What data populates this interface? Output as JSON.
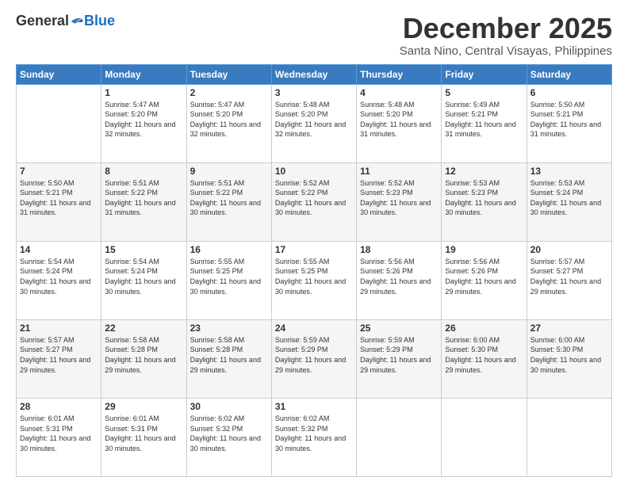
{
  "header": {
    "logo": {
      "general": "General",
      "blue": "Blue"
    },
    "title": "December 2025",
    "location": "Santa Nino, Central Visayas, Philippines"
  },
  "calendar": {
    "days_of_week": [
      "Sunday",
      "Monday",
      "Tuesday",
      "Wednesday",
      "Thursday",
      "Friday",
      "Saturday"
    ],
    "weeks": [
      [
        {
          "day": "",
          "sunrise": "",
          "sunset": "",
          "daylight": ""
        },
        {
          "day": "1",
          "sunrise": "Sunrise: 5:47 AM",
          "sunset": "Sunset: 5:20 PM",
          "daylight": "Daylight: 11 hours and 32 minutes."
        },
        {
          "day": "2",
          "sunrise": "Sunrise: 5:47 AM",
          "sunset": "Sunset: 5:20 PM",
          "daylight": "Daylight: 11 hours and 32 minutes."
        },
        {
          "day": "3",
          "sunrise": "Sunrise: 5:48 AM",
          "sunset": "Sunset: 5:20 PM",
          "daylight": "Daylight: 11 hours and 32 minutes."
        },
        {
          "day": "4",
          "sunrise": "Sunrise: 5:48 AM",
          "sunset": "Sunset: 5:20 PM",
          "daylight": "Daylight: 11 hours and 31 minutes."
        },
        {
          "day": "5",
          "sunrise": "Sunrise: 5:49 AM",
          "sunset": "Sunset: 5:21 PM",
          "daylight": "Daylight: 11 hours and 31 minutes."
        },
        {
          "day": "6",
          "sunrise": "Sunrise: 5:50 AM",
          "sunset": "Sunset: 5:21 PM",
          "daylight": "Daylight: 11 hours and 31 minutes."
        }
      ],
      [
        {
          "day": "7",
          "sunrise": "Sunrise: 5:50 AM",
          "sunset": "Sunset: 5:21 PM",
          "daylight": "Daylight: 11 hours and 31 minutes."
        },
        {
          "day": "8",
          "sunrise": "Sunrise: 5:51 AM",
          "sunset": "Sunset: 5:22 PM",
          "daylight": "Daylight: 11 hours and 31 minutes."
        },
        {
          "day": "9",
          "sunrise": "Sunrise: 5:51 AM",
          "sunset": "Sunset: 5:22 PM",
          "daylight": "Daylight: 11 hours and 30 minutes."
        },
        {
          "day": "10",
          "sunrise": "Sunrise: 5:52 AM",
          "sunset": "Sunset: 5:22 PM",
          "daylight": "Daylight: 11 hours and 30 minutes."
        },
        {
          "day": "11",
          "sunrise": "Sunrise: 5:52 AM",
          "sunset": "Sunset: 5:23 PM",
          "daylight": "Daylight: 11 hours and 30 minutes."
        },
        {
          "day": "12",
          "sunrise": "Sunrise: 5:53 AM",
          "sunset": "Sunset: 5:23 PM",
          "daylight": "Daylight: 11 hours and 30 minutes."
        },
        {
          "day": "13",
          "sunrise": "Sunrise: 5:53 AM",
          "sunset": "Sunset: 5:24 PM",
          "daylight": "Daylight: 11 hours and 30 minutes."
        }
      ],
      [
        {
          "day": "14",
          "sunrise": "Sunrise: 5:54 AM",
          "sunset": "Sunset: 5:24 PM",
          "daylight": "Daylight: 11 hours and 30 minutes."
        },
        {
          "day": "15",
          "sunrise": "Sunrise: 5:54 AM",
          "sunset": "Sunset: 5:24 PM",
          "daylight": "Daylight: 11 hours and 30 minutes."
        },
        {
          "day": "16",
          "sunrise": "Sunrise: 5:55 AM",
          "sunset": "Sunset: 5:25 PM",
          "daylight": "Daylight: 11 hours and 30 minutes."
        },
        {
          "day": "17",
          "sunrise": "Sunrise: 5:55 AM",
          "sunset": "Sunset: 5:25 PM",
          "daylight": "Daylight: 11 hours and 30 minutes."
        },
        {
          "day": "18",
          "sunrise": "Sunrise: 5:56 AM",
          "sunset": "Sunset: 5:26 PM",
          "daylight": "Daylight: 11 hours and 29 minutes."
        },
        {
          "day": "19",
          "sunrise": "Sunrise: 5:56 AM",
          "sunset": "Sunset: 5:26 PM",
          "daylight": "Daylight: 11 hours and 29 minutes."
        },
        {
          "day": "20",
          "sunrise": "Sunrise: 5:57 AM",
          "sunset": "Sunset: 5:27 PM",
          "daylight": "Daylight: 11 hours and 29 minutes."
        }
      ],
      [
        {
          "day": "21",
          "sunrise": "Sunrise: 5:57 AM",
          "sunset": "Sunset: 5:27 PM",
          "daylight": "Daylight: 11 hours and 29 minutes."
        },
        {
          "day": "22",
          "sunrise": "Sunrise: 5:58 AM",
          "sunset": "Sunset: 5:28 PM",
          "daylight": "Daylight: 11 hours and 29 minutes."
        },
        {
          "day": "23",
          "sunrise": "Sunrise: 5:58 AM",
          "sunset": "Sunset: 5:28 PM",
          "daylight": "Daylight: 11 hours and 29 minutes."
        },
        {
          "day": "24",
          "sunrise": "Sunrise: 5:59 AM",
          "sunset": "Sunset: 5:29 PM",
          "daylight": "Daylight: 11 hours and 29 minutes."
        },
        {
          "day": "25",
          "sunrise": "Sunrise: 5:59 AM",
          "sunset": "Sunset: 5:29 PM",
          "daylight": "Daylight: 11 hours and 29 minutes."
        },
        {
          "day": "26",
          "sunrise": "Sunrise: 6:00 AM",
          "sunset": "Sunset: 5:30 PM",
          "daylight": "Daylight: 11 hours and 29 minutes."
        },
        {
          "day": "27",
          "sunrise": "Sunrise: 6:00 AM",
          "sunset": "Sunset: 5:30 PM",
          "daylight": "Daylight: 11 hours and 30 minutes."
        }
      ],
      [
        {
          "day": "28",
          "sunrise": "Sunrise: 6:01 AM",
          "sunset": "Sunset: 5:31 PM",
          "daylight": "Daylight: 11 hours and 30 minutes."
        },
        {
          "day": "29",
          "sunrise": "Sunrise: 6:01 AM",
          "sunset": "Sunset: 5:31 PM",
          "daylight": "Daylight: 11 hours and 30 minutes."
        },
        {
          "day": "30",
          "sunrise": "Sunrise: 6:02 AM",
          "sunset": "Sunset: 5:32 PM",
          "daylight": "Daylight: 11 hours and 30 minutes."
        },
        {
          "day": "31",
          "sunrise": "Sunrise: 6:02 AM",
          "sunset": "Sunset: 5:32 PM",
          "daylight": "Daylight: 11 hours and 30 minutes."
        },
        {
          "day": "",
          "sunrise": "",
          "sunset": "",
          "daylight": ""
        },
        {
          "day": "",
          "sunrise": "",
          "sunset": "",
          "daylight": ""
        },
        {
          "day": "",
          "sunrise": "",
          "sunset": "",
          "daylight": ""
        }
      ]
    ]
  }
}
